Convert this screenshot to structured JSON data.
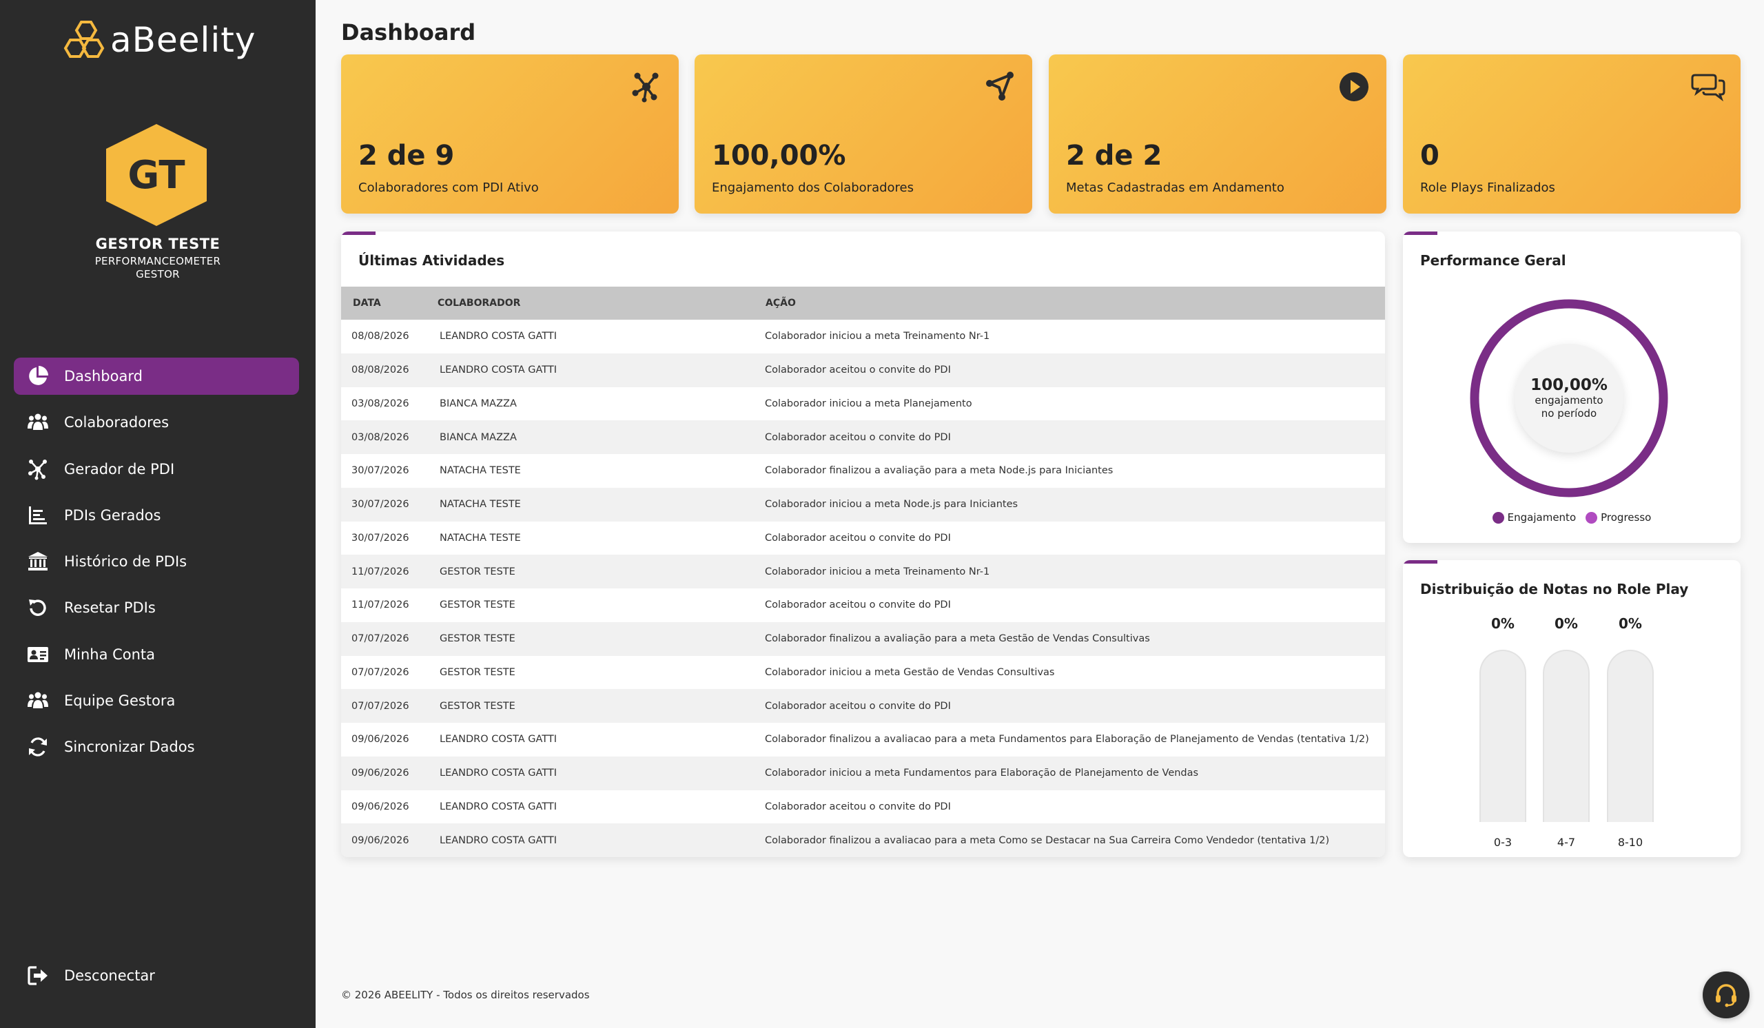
{
  "brand": {
    "name": "aBeelity",
    "accent": "#7a2d86",
    "gold": "#f5b93f"
  },
  "user": {
    "initials": "GT",
    "name": "GESTOR TESTE",
    "company": "PERFORMANCEOMETER",
    "role": "GESTOR"
  },
  "nav": {
    "items": [
      {
        "label": "Dashboard",
        "icon": "pie-chart-icon",
        "active": true
      },
      {
        "label": "Colaboradores",
        "icon": "people-group-icon"
      },
      {
        "label": "Gerador de PDI",
        "icon": "network-icon"
      },
      {
        "label": "PDIs Gerados",
        "icon": "bar-chart-icon"
      },
      {
        "label": "Histórico de PDIs",
        "icon": "institution-icon"
      },
      {
        "label": "Resetar PDIs",
        "icon": "reset-icon"
      },
      {
        "label": "Minha Conta",
        "icon": "id-card-icon"
      },
      {
        "label": "Equipe Gestora",
        "icon": "people-group-icon"
      },
      {
        "label": "Sincronizar Dados",
        "icon": "sync-icon"
      }
    ],
    "logout": "Desconectar"
  },
  "page": {
    "title": "Dashboard"
  },
  "stats": [
    {
      "value": "2 de 9",
      "label": "Colaboradores com PDI Ativo",
      "icon": "network-icon"
    },
    {
      "value": "100,00%",
      "label": "Engajamento dos Colaboradores",
      "icon": "share-icon"
    },
    {
      "value": "2 de 2",
      "label": "Metas Cadastradas em Andamento",
      "icon": "play-icon"
    },
    {
      "value": "0",
      "label": "Role Plays Finalizados",
      "icon": "chat-icon"
    }
  ],
  "activities": {
    "title": "Últimas Atividades",
    "columns": [
      "DATA",
      "COLABORADOR",
      "AÇÃO"
    ],
    "rows": [
      [
        "08/08/2026",
        "LEANDRO COSTA GATTI",
        "Colaborador iniciou a meta Treinamento Nr-1"
      ],
      [
        "08/08/2026",
        "LEANDRO COSTA GATTI",
        "Colaborador aceitou o convite do PDI"
      ],
      [
        "03/08/2026",
        "BIANCA MAZZA",
        "Colaborador iniciou a meta Planejamento"
      ],
      [
        "03/08/2026",
        "BIANCA MAZZA",
        "Colaborador aceitou o convite do PDI"
      ],
      [
        "30/07/2026",
        "NATACHA TESTE",
        "Colaborador finalizou a avaliação para a meta Node.js para Iniciantes"
      ],
      [
        "30/07/2026",
        "NATACHA TESTE",
        "Colaborador iniciou a meta Node.js para Iniciantes"
      ],
      [
        "30/07/2026",
        "NATACHA TESTE",
        "Colaborador aceitou o convite do PDI"
      ],
      [
        "11/07/2026",
        "GESTOR TESTE",
        "Colaborador iniciou a meta Treinamento Nr-1"
      ],
      [
        "11/07/2026",
        "GESTOR TESTE",
        "Colaborador aceitou o convite do PDI"
      ],
      [
        "07/07/2026",
        "GESTOR TESTE",
        "Colaborador finalizou a avaliação para a meta Gestão de Vendas Consultivas"
      ],
      [
        "07/07/2026",
        "GESTOR TESTE",
        "Colaborador iniciou a meta Gestão de Vendas Consultivas"
      ],
      [
        "07/07/2026",
        "GESTOR TESTE",
        "Colaborador aceitou o convite do PDI"
      ],
      [
        "09/06/2026",
        "LEANDRO COSTA GATTI",
        "Colaborador finalizou a avaliacao para a meta Fundamentos para Elaboração de Planejamento de Vendas (tentativa 1/2)"
      ],
      [
        "09/06/2026",
        "LEANDRO COSTA GATTI",
        "Colaborador iniciou a meta Fundamentos para Elaboração de Planejamento de Vendas"
      ],
      [
        "09/06/2026",
        "LEANDRO COSTA GATTI",
        "Colaborador aceitou o convite do PDI"
      ],
      [
        "09/06/2026",
        "LEANDRO COSTA GATTI",
        "Colaborador finalizou a avaliacao para a meta Como se Destacar na Sua Carreira Como Vendedor (tentativa 1/2)"
      ]
    ]
  },
  "performance": {
    "title": "Performance Geral",
    "value": "100,00%",
    "caption_line1": "engajamento",
    "caption_line2": "no período",
    "engagement_fraction": 1.0,
    "legend": [
      {
        "label": "Engajamento",
        "color": "#7a2d86"
      },
      {
        "label": "Progresso",
        "color": "#b04bc0"
      }
    ]
  },
  "roleplay": {
    "title": "Distribuição de Notas no Role Play",
    "bars": [
      {
        "category": "0-3",
        "pct_label": "0%",
        "value": 0
      },
      {
        "category": "4-7",
        "pct_label": "0%",
        "value": 0
      },
      {
        "category": "8-10",
        "pct_label": "0%",
        "value": 0
      }
    ]
  },
  "footer": {
    "text": "© 2026 ABEELITY - Todos os direitos reservados"
  },
  "support": {
    "icon": "headset-icon"
  }
}
